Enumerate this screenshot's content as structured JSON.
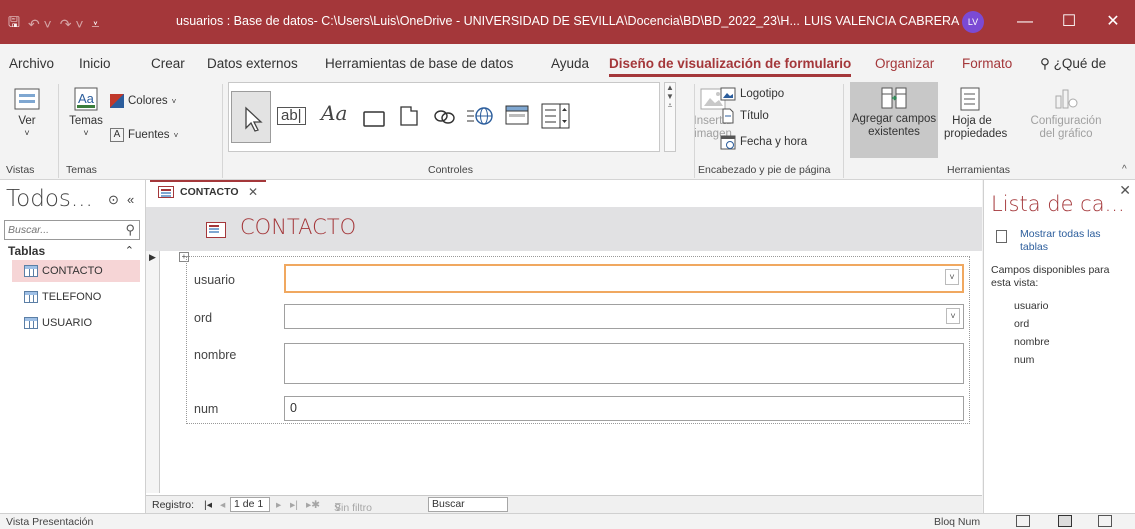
{
  "titlebar": {
    "doc_title": "usuarios : Base de datos- C:\\Users\\Luis\\OneDrive - UNIVERSIDAD DE SEVILLA\\Docencia\\BD\\BD_2022_23\\H...",
    "user_name": "LUIS VALENCIA CABRERA",
    "user_initials": "LV",
    "minimize_glyph": "—",
    "restore_glyph": "☐",
    "close_glyph": "✕"
  },
  "ribbon_tabs": [
    "Archivo",
    "Inicio",
    "Crear",
    "Datos externos",
    "Herramientas de base de datos",
    "Ayuda",
    "Diseño de visualización de formulario",
    "Organizar",
    "Formato",
    "¿Qué de"
  ],
  "ribbon": {
    "ver_label": "Ver",
    "temas_label": "Temas",
    "colores_label": "Colores",
    "fuentes_label": "Fuentes",
    "insertar_imagen_label": "Insertar imagen",
    "logotipo_label": "Logotipo",
    "titulo_label": "Título",
    "fecha_hora_label": "Fecha y hora",
    "agregar_campos_label": "Agregar campos existentes",
    "hoja_propiedades_label": "Hoja de propiedades",
    "configuracion_grafico_label": "Configuración del gráfico",
    "groups": {
      "vistas": "Vistas",
      "temas": "Temas",
      "controles": "Controles",
      "encabezado": "Encabezado y pie de página",
      "herramientas": "Herramientas"
    },
    "text_box_glyph": "ab|",
    "label_glyph": "Aa"
  },
  "navpane": {
    "title": "Todos...",
    "search_placeholder": "Buscar...",
    "group_label": "Tablas",
    "items": [
      "CONTACTO",
      "TELEFONO",
      "USUARIO"
    ]
  },
  "document": {
    "tab_label": "CONTACTO",
    "form_title": "CONTACTO",
    "fields": [
      {
        "label": "usuario",
        "value": ""
      },
      {
        "label": "ord",
        "value": ""
      },
      {
        "label": "nombre",
        "value": ""
      },
      {
        "label": "num",
        "value": "0"
      }
    ]
  },
  "recnav": {
    "registro_label": "Registro:",
    "position": "1 de 1",
    "filter_label": "Sin filtro",
    "search_label": "Buscar"
  },
  "fieldlist": {
    "title": "Lista de ca...",
    "show_all_label": "Mostrar todas las tablas",
    "available_label": "Campos disponibles para esta vista:",
    "fields": [
      "usuario",
      "ord",
      "nombre",
      "num"
    ]
  },
  "statusbar": {
    "left_text": "Vista Presentación",
    "right_text": "Bloq Num"
  },
  "colors": {
    "accent": "#a4373a",
    "avatar": "#7b4ad4",
    "active_field_border": "#f0a860"
  }
}
